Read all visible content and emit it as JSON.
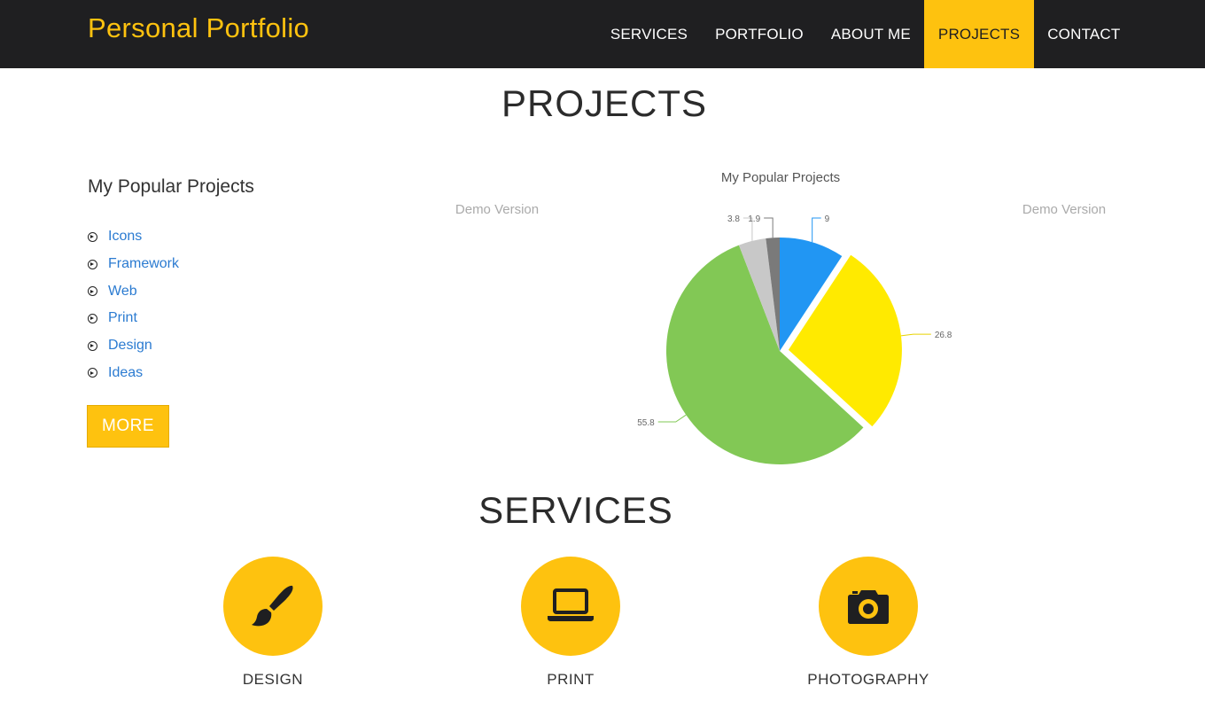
{
  "brand": "Personal Portfolio",
  "nav": [
    {
      "label": "SERVICES",
      "active": false
    },
    {
      "label": "PORTFOLIO",
      "active": false
    },
    {
      "label": "ABOUT ME",
      "active": false
    },
    {
      "label": "PROJECTS",
      "active": true
    },
    {
      "label": "CONTACT",
      "active": false
    }
  ],
  "projects": {
    "title": "PROJECTS",
    "list_heading": "My Popular Projects",
    "items": [
      "Icons",
      "Framework",
      "Web",
      "Print",
      "Design",
      "Ideas"
    ],
    "more_label": "MORE"
  },
  "chart_data": {
    "type": "pie",
    "title": "My Popular Projects",
    "watermark": "Demo Version",
    "slices": [
      {
        "value": 9,
        "label": "9",
        "color": "#2196f3",
        "exploded": false
      },
      {
        "value": 26.8,
        "label": "26.8",
        "color": "#ffea00",
        "exploded": true
      },
      {
        "value": 55.8,
        "label": "55.8",
        "color": "#82c855",
        "exploded": false
      },
      {
        "value": 3.8,
        "label": "3.8",
        "color": "#c8c8c8",
        "exploded": false
      },
      {
        "value": 1.9,
        "label": "1.9",
        "color": "#7a7a7a",
        "exploded": false
      }
    ]
  },
  "services": {
    "title": "SERVICES",
    "items": [
      {
        "label": "DESIGN",
        "icon": "paintbrush-icon"
      },
      {
        "label": "PRINT",
        "icon": "laptop-icon"
      },
      {
        "label": "PHOTOGRAPHY",
        "icon": "camera-icon"
      }
    ]
  },
  "colors": {
    "accent": "#fec20f",
    "navbar": "#1f1f21",
    "link": "#2b7bd1"
  }
}
